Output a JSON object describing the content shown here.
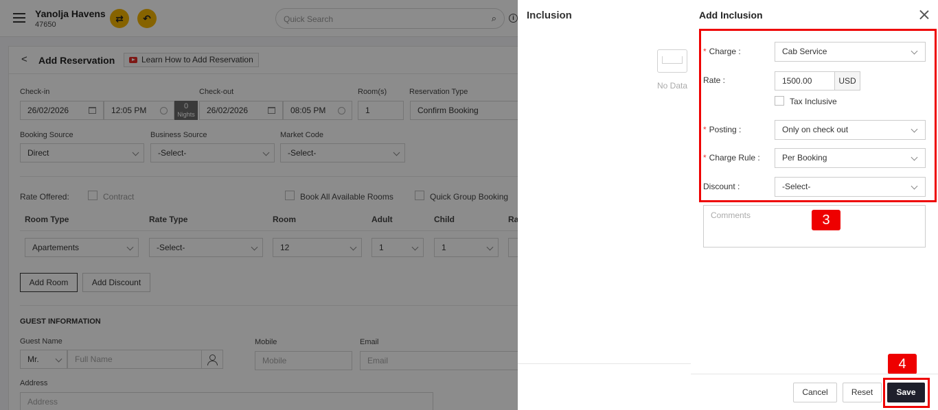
{
  "topbar": {
    "hotel_name": "Yanolja Havens",
    "hotel_code": "47650",
    "search_placeholder": "Quick Search"
  },
  "page": {
    "title": "Add Reservation",
    "learn_link": "Learn How to Add Reservation"
  },
  "stay": {
    "checkin_label": "Check-in",
    "checkin_date": "26/02/2026",
    "checkin_time": "12:05 PM",
    "nights": "0",
    "nights_label": "Nights",
    "checkout_label": "Check-out",
    "checkout_date": "26/02/2026",
    "checkout_time": "08:05 PM",
    "rooms_label": "Room(s)",
    "rooms": "1",
    "reservation_type_label": "Reservation Type",
    "reservation_type": "Confirm Booking"
  },
  "sources": {
    "booking_source_label": "Booking Source",
    "booking_source": "Direct",
    "business_source_label": "Business Source",
    "business_source": "-Select-",
    "market_code_label": "Market Code",
    "market_code": "-Select-"
  },
  "rate_options": {
    "rate_offered_label": "Rate Offered:",
    "contract": "Contract",
    "book_all": "Book All Available Rooms",
    "group_booking": "Quick Group Booking"
  },
  "room_table": {
    "headers": [
      "Room Type",
      "Rate Type",
      "Room",
      "Adult",
      "Child",
      "Ra"
    ],
    "row": {
      "room_type": "Apartements",
      "rate_type": "-Select-",
      "room": "12",
      "adult": "1",
      "child": "1"
    },
    "add_room": "Add Room",
    "add_discount": "Add Discount"
  },
  "guest": {
    "section_title": "GUEST INFORMATION",
    "name_label": "Guest Name",
    "salutation": "Mr.",
    "name_placeholder": "Full Name",
    "mobile_label": "Mobile",
    "mobile_placeholder": "Mobile",
    "email_label": "Email",
    "email_placeholder": "Email",
    "address_label": "Address",
    "address_placeholder": "Address"
  },
  "inclusion_panel": {
    "title": "Inclusion",
    "empty": "No Data"
  },
  "add_inclusion": {
    "title": "Add Inclusion",
    "charge_label": "Charge :",
    "charge": "Cab Service",
    "rate_label": "Rate :",
    "rate": "1500.00",
    "currency": "USD",
    "tax_inclusive": "Tax Inclusive",
    "posting_label": "Posting :",
    "posting": "Only on check out",
    "charge_rule_label": "Charge Rule :",
    "charge_rule": "Per Booking",
    "discount_label": "Discount :",
    "discount": "-Select-",
    "comments_placeholder": "Comments",
    "cancel": "Cancel",
    "reset": "Reset",
    "save": "Save"
  },
  "annotations": {
    "step_3": "3",
    "step_4": "4"
  },
  "colors": {
    "accent": "#f5b400",
    "highlight": "#ee0000",
    "save_button": "#1e1f2b",
    "required": "#e53935"
  }
}
